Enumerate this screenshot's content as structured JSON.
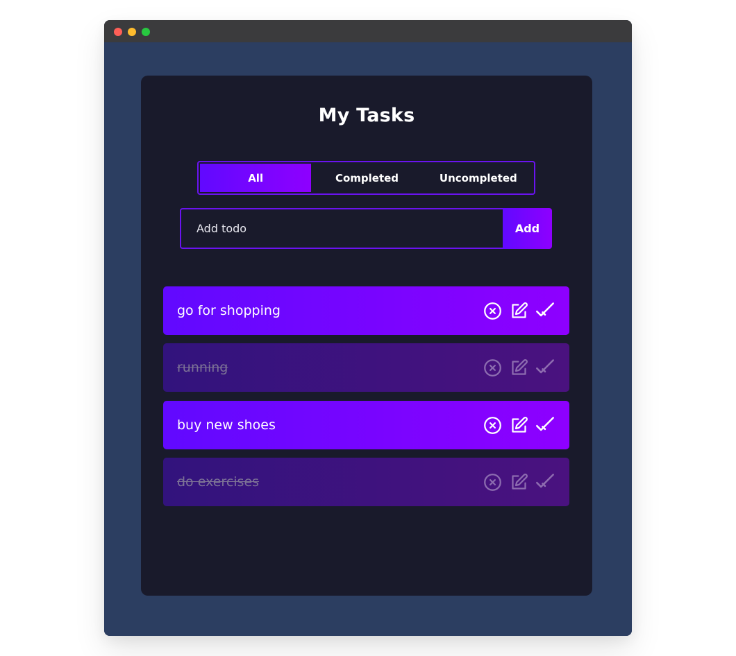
{
  "app": {
    "title": "My Tasks"
  },
  "filters": [
    {
      "label": "All",
      "active": true
    },
    {
      "label": "Completed",
      "active": false
    },
    {
      "label": "Uncompleted",
      "active": false
    }
  ],
  "add": {
    "placeholder": "Add todo",
    "button_label": "Add"
  },
  "todos": [
    {
      "text": "go for shopping",
      "completed": false
    },
    {
      "text": "running",
      "completed": true
    },
    {
      "text": "buy new shoes",
      "completed": false
    },
    {
      "text": "do exercises",
      "completed": true
    }
  ],
  "icons": {
    "delete": "x-circle-icon",
    "edit": "edit-icon",
    "complete": "check-icon"
  },
  "colors": {
    "page_bg": "#2c3e61",
    "app_bg": "#191a2b",
    "accent_start": "#6109ff",
    "accent_end": "#8e00ff",
    "border": "#6a13f0",
    "done_start": "#32137d",
    "done_end": "#4a127f"
  }
}
